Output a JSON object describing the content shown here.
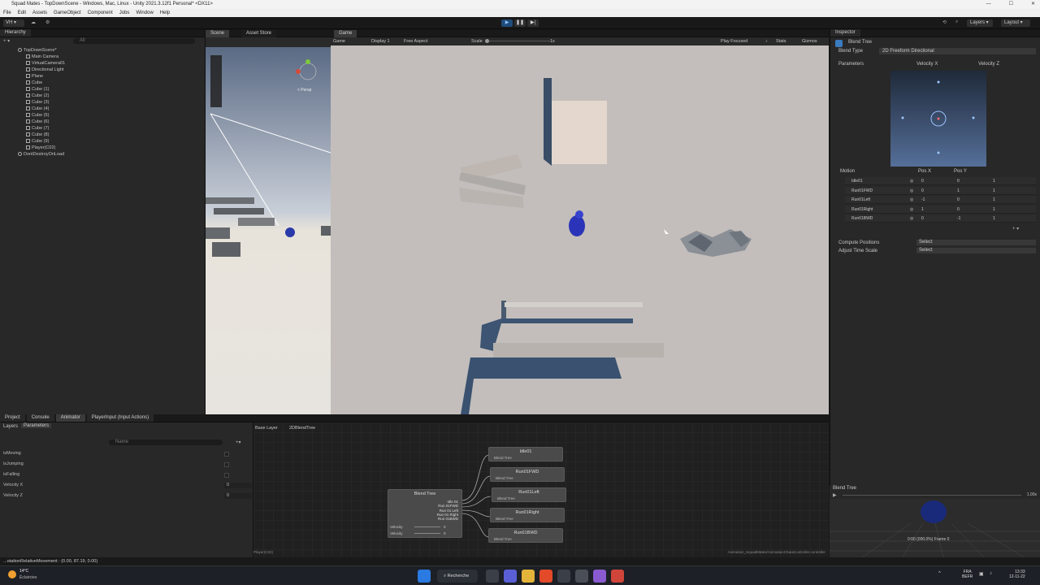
{
  "window": {
    "title": "Squad Mates - TopDownScene - Windows, Mac, Linux - Unity 2021.3.12f1 Personal* <DX11>"
  },
  "menu": [
    "File",
    "Edit",
    "Assets",
    "GameObject",
    "Component",
    "Jobs",
    "Window",
    "Help"
  ],
  "toolbar": {
    "account": "VH",
    "layers": "Layers",
    "layout": "Layout"
  },
  "hierarchy": {
    "tab": "Hierarchy",
    "search": "All",
    "items": [
      {
        "label": "TopDownScene*",
        "indent": 0,
        "kind": "scene"
      },
      {
        "label": "Main Camera",
        "indent": 1,
        "kind": "obj"
      },
      {
        "label": "VirtualCamera01",
        "indent": 1,
        "kind": "obj"
      },
      {
        "label": "Directional Light",
        "indent": 1,
        "kind": "obj"
      },
      {
        "label": "Plane",
        "indent": 1,
        "kind": "obj"
      },
      {
        "label": "Cube",
        "indent": 1,
        "kind": "obj"
      },
      {
        "label": "Cube (1)",
        "indent": 1,
        "kind": "obj"
      },
      {
        "label": "Cube (2)",
        "indent": 1,
        "kind": "obj"
      },
      {
        "label": "Cube (3)",
        "indent": 1,
        "kind": "obj"
      },
      {
        "label": "Cube (4)",
        "indent": 1,
        "kind": "obj"
      },
      {
        "label": "Cube (5)",
        "indent": 1,
        "kind": "obj"
      },
      {
        "label": "Cube (6)",
        "indent": 1,
        "kind": "obj"
      },
      {
        "label": "Cube (7)",
        "indent": 1,
        "kind": "obj"
      },
      {
        "label": "Cube (8)",
        "indent": 1,
        "kind": "obj"
      },
      {
        "label": "Cube (9)",
        "indent": 1,
        "kind": "obj"
      },
      {
        "label": "Player(C02)",
        "indent": 1,
        "kind": "obj"
      },
      {
        "label": "DontDestroyOnLoad",
        "indent": 0,
        "kind": "scene"
      }
    ]
  },
  "scene_tabs": {
    "scene": "Scene",
    "asset_store": "Asset Store",
    "persp": "< Persp"
  },
  "game": {
    "tab": "Game",
    "display_mode": "Game",
    "display": "Display 1",
    "aspect": "Free Aspect",
    "scale_label": "Scale",
    "scale": "1x",
    "play_focused": "Play Focused",
    "stats": "Stats",
    "gizmos": "Gizmos"
  },
  "inspector": {
    "tab": "Inspector",
    "object": "Blend Tree",
    "blend_type_label": "Blend Type",
    "blend_type": "2D Freeform Directional",
    "parameters_label": "Parameters",
    "param_x": "Velocity X",
    "param_z": "Velocity Z",
    "motion_headers": [
      "Motion",
      "Pos X",
      "Pos Y"
    ],
    "motions": [
      {
        "name": "Idle01",
        "x": "0",
        "y": "0",
        "speed": "1"
      },
      {
        "name": "Run01FWD",
        "x": "0",
        "y": "1",
        "speed": "1"
      },
      {
        "name": "Run01Left",
        "x": "-1",
        "y": "0",
        "speed": "1"
      },
      {
        "name": "Run01Right",
        "x": "1",
        "y": "0",
        "speed": "1"
      },
      {
        "name": "Run01BWD",
        "x": "0",
        "y": "-1",
        "speed": "1"
      }
    ],
    "compute_label": "Compute Positions",
    "compute_value": "Select",
    "adjust_label": "Adjust Time Scale",
    "adjust_value": "Select"
  },
  "bottom_tabs": [
    "Project",
    "Console",
    "Animator",
    "PlayerInput (Input Actions)"
  ],
  "animator": {
    "layers": "Layers",
    "parameters": "Parameters",
    "search": "Name",
    "breadcrumb_base": "Base Layer",
    "breadcrumb_tree": "2DBlendTree",
    "params": [
      {
        "name": "isMoving",
        "type": "bool"
      },
      {
        "name": "isJumping",
        "type": "bool"
      },
      {
        "name": "isFalling",
        "type": "bool"
      },
      {
        "name": "Velocity X",
        "type": "float",
        "value": "0"
      },
      {
        "name": "Velocity Z",
        "type": "float",
        "value": "0"
      }
    ],
    "root_node": {
      "title": "Blend Tree",
      "children": [
        "Idle 01",
        "Run 01FWD",
        "Run 01 Left",
        "Run 01 Right",
        "Run 01BWD"
      ],
      "inputs": [
        {
          "name": "Velocity",
          "value": "0"
        },
        {
          "name": "Velocity",
          "value": "0"
        }
      ]
    },
    "child_nodes": [
      {
        "title": "Idle01",
        "sub": "Blend Tree"
      },
      {
        "title": "Run01FWD",
        "sub": "Blend Tree"
      },
      {
        "title": "Run01Left",
        "sub": "Blend Tree"
      },
      {
        "title": "Run01Right",
        "sub": "Blend Tree"
      },
      {
        "title": "Run01BWD",
        "sub": "Blend Tree"
      }
    ],
    "footer_left": "Player(C02)",
    "footer_right": "Animation_SquadMates/AnimationCharaController.controller"
  },
  "preview": {
    "title": "Blend Tree",
    "speed": "1.00x",
    "frame": "0:00 (000.0%) Frame 0"
  },
  "status": {
    "text": "...otationRelativeMovement : (0.00, 87.19, 0.00)"
  },
  "taskbar": {
    "temp": "14°C",
    "weather": "Éclaircies",
    "search": "Recherche",
    "lang": "FRA",
    "region": "BEFR",
    "time": "13:33",
    "date": "12-11-22"
  },
  "colors": {
    "accent": "#2c5d87",
    "play": "#1f4b7a"
  }
}
